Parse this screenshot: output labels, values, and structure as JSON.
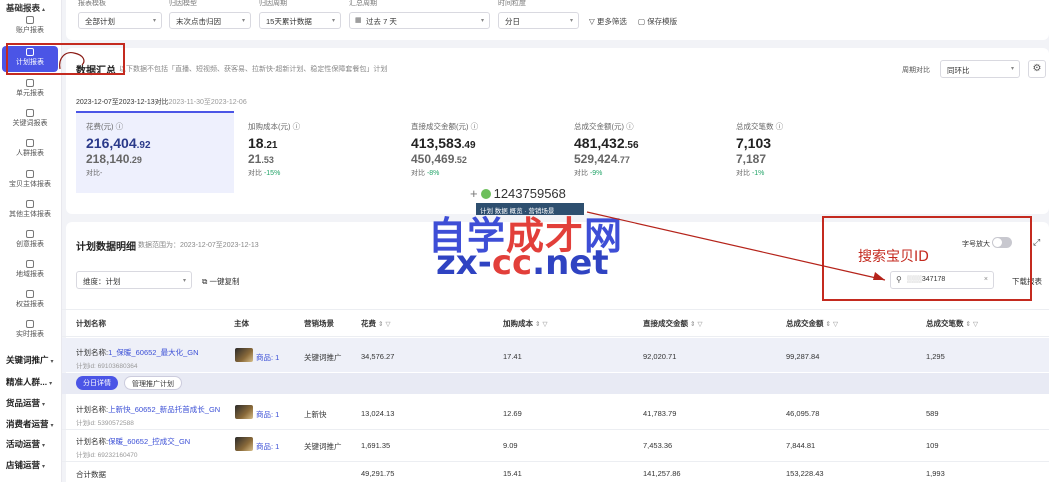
{
  "sidebar": {
    "header": "基础报表",
    "items": [
      {
        "label": "账户报表"
      },
      {
        "label": "计划报表"
      },
      {
        "label": "单元报表"
      },
      {
        "label": "关键词报表"
      },
      {
        "label": "人群报表"
      },
      {
        "label": "宝贝主体报表"
      },
      {
        "label": "其他主体报表"
      },
      {
        "label": "创意报表"
      },
      {
        "label": "地域报表"
      },
      {
        "label": "权益报表"
      },
      {
        "label": "实时报表"
      }
    ],
    "groups": [
      "关键词推广",
      "精准人群...",
      "货品运营",
      "消费者运营",
      "活动运营",
      "店铺运营"
    ]
  },
  "filters": {
    "labels": [
      "报表模板",
      "归因模型",
      "归因周期",
      "汇总周期",
      "时间粒度"
    ],
    "values": [
      "全部计划",
      "末次点击归因",
      "15天累计数据",
      "过去 7 天",
      "分日"
    ],
    "more_filter": "更多筛选",
    "save_template": "保存模版"
  },
  "summary": {
    "title": "数据汇总",
    "note": "以下数据不包括「直播、短视频、获客易、拉新快-超新计划、稳定性保障套餐包」计划",
    "period_compare_label": "周期对比",
    "period_compare_value": "同环比",
    "date_current": "2023-12-07至2023-12-13",
    "date_compare_label": "对比",
    "date_compare": "2023-11-30至2023-12-06",
    "metrics": [
      {
        "label": "花费(元)",
        "value_main": "216,404",
        "value_dec": ".92",
        "prev_main": "218,140",
        "prev_dec": ".29",
        "compare": "对比-",
        "delta": ""
      },
      {
        "label": "加购成本(元)",
        "value_main": "18",
        "value_dec": ".21",
        "prev_main": "21",
        "prev_dec": ".53",
        "compare": "对比",
        "delta": "-15%"
      },
      {
        "label": "直接成交金额(元)",
        "value_main": "413,583",
        "value_dec": ".49",
        "prev_main": "450,469",
        "prev_dec": ".52",
        "compare": "对比",
        "delta": "-8%"
      },
      {
        "label": "总成交金额(元)",
        "value_main": "481,432",
        "value_dec": ".56",
        "prev_main": "529,424",
        "prev_dec": ".77",
        "compare": "对比",
        "delta": "-9%"
      },
      {
        "label": "总成交笔数",
        "value_main": "7,103",
        "value_dec": "",
        "prev_main": "7,187",
        "prev_dec": "",
        "compare": "对比",
        "delta": "-1%"
      }
    ]
  },
  "watermark": {
    "phone": "1243759568",
    "tag": "计划 数据 概览 · 营销场景",
    "big_a": "自学",
    "big_b": "成才",
    "big_c": "网",
    "url_a": "zx-",
    "url_b": "cc",
    "url_c": ".net"
  },
  "detail": {
    "title": "计划数据明细",
    "period": "数据范围为：2023-12-07至2023-12-13",
    "zoom_label": "字号放大",
    "dimension": "维度：计划",
    "copy_label": "一键复制",
    "search_value": "347178",
    "download_label": "下载报表",
    "annotation": "搜索宝贝ID"
  },
  "table": {
    "headers": [
      "计划名称",
      "主体",
      "营销场景",
      "花费",
      "加购成本",
      "直接成交金额",
      "总成交金额",
      "总成交笔数"
    ],
    "rows": [
      {
        "name_prefix": "计划名称:",
        "name": "1_保暖_60652_最大化_GN",
        "id": "计划id: 69103680364",
        "subject": "商品: 1",
        "scene": "关键词推广",
        "cost": "34,576.27",
        "cart_cost": "17.41",
        "direct": "92,020.71",
        "total": "99,287.84",
        "orders": "1,295"
      },
      {
        "name_prefix": "计划名称:",
        "name": "上新快_60652_新品托首成长_GN",
        "id": "计划id: 5390572588",
        "subject": "商品: 1",
        "scene": "上新快",
        "cost": "13,024.13",
        "cart_cost": "12.69",
        "direct": "41,783.79",
        "total": "46,095.78",
        "orders": "589"
      },
      {
        "name_prefix": "计划名称:",
        "name": "保暖_60652_控成交_GN",
        "id": "计划id: 69232160470",
        "subject": "商品: 1",
        "scene": "关键词推广",
        "cost": "1,691.35",
        "cart_cost": "9.09",
        "direct": "7,453.36",
        "total": "7,844.81",
        "orders": "109"
      }
    ],
    "subtabs": [
      "分日详情",
      "管理推广计划"
    ],
    "total_row": {
      "label": "合计数据",
      "cost": "49,291.75",
      "cart_cost": "15.41",
      "direct": "141,257.86",
      "total": "153,228.43",
      "orders": "1,993"
    }
  }
}
